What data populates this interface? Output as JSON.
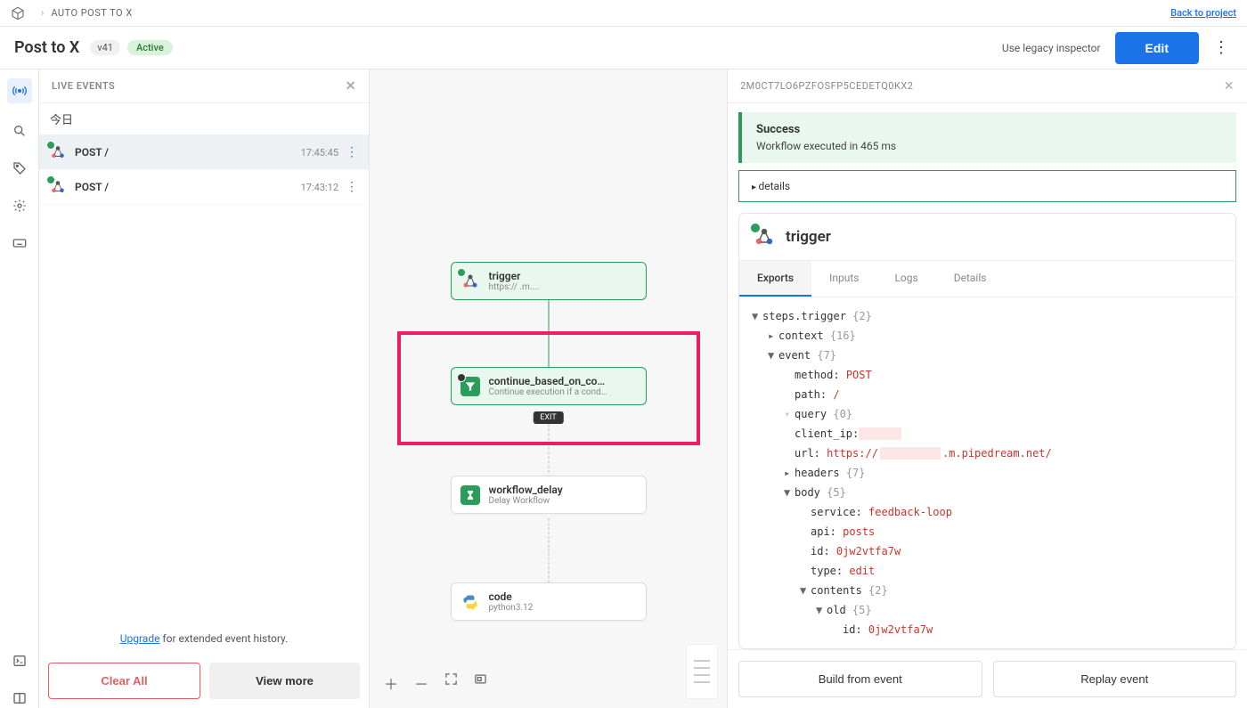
{
  "topbar": {
    "breadcrumb": "AUTO POST TO X",
    "back_link": "Back to project"
  },
  "header": {
    "title": "Post to X",
    "version": "v41",
    "status": "Active",
    "legacy": "Use legacy inspector",
    "edit": "Edit"
  },
  "left": {
    "title": "LIVE EVENTS",
    "day": "今日",
    "events": [
      {
        "label": "POST /",
        "time": "17:45:45"
      },
      {
        "label": "POST /",
        "time": "17:43:12"
      }
    ],
    "upgrade_link": "Upgrade",
    "upgrade_text": " for extended event history.",
    "clear": "Clear All",
    "view_more": "View more"
  },
  "canvas": {
    "nodes": {
      "trigger": {
        "title": "trigger",
        "sub": "https://                       .m...."
      },
      "cond": {
        "title": "continue_based_on_co…",
        "sub": "Continue execution if a cond…"
      },
      "delay": {
        "title": "workflow_delay",
        "sub": "Delay Workflow"
      },
      "code": {
        "title": "code",
        "sub": "python3.12"
      }
    },
    "exit": "EXIT"
  },
  "right": {
    "run_id": "2M0CT7LO6PZFOSFP5CEDETQ0KX2",
    "success_title": "Success",
    "success_sub": "Workflow executed in 465 ms",
    "details": "details",
    "step_title": "trigger",
    "tabs": [
      "Exports",
      "Inputs",
      "Logs",
      "Details"
    ],
    "tree": {
      "root": "steps.trigger",
      "root_c": "{2}",
      "context": "context",
      "context_c": "{16}",
      "event": "event",
      "event_c": "{7}",
      "method_k": "method:",
      "method_v": "POST",
      "path_k": "path:",
      "path_v": "/",
      "query": "query",
      "query_c": "{0}",
      "client_k": "client_ip:",
      "client_v": "",
      "url_k": "url:",
      "url_v1": "https://",
      "url_v2": ".m.pipedream.net/",
      "headers": "headers",
      "headers_c": "{7}",
      "body": "body",
      "body_c": "{5}",
      "service_k": "service:",
      "service_v": "feedback-loop",
      "api_k": "api:",
      "api_v": "posts",
      "id_k": "id:",
      "id_v": "0jw2vtfa7w",
      "type_k": "type:",
      "type_v": "edit",
      "contents": "contents",
      "contents_c": "{2}",
      "old": "old",
      "old_c": "{5}",
      "old_id_k": "id:",
      "old_id_v": "0jw2vtfa7w"
    },
    "build": "Build from event",
    "replay": "Replay event"
  }
}
